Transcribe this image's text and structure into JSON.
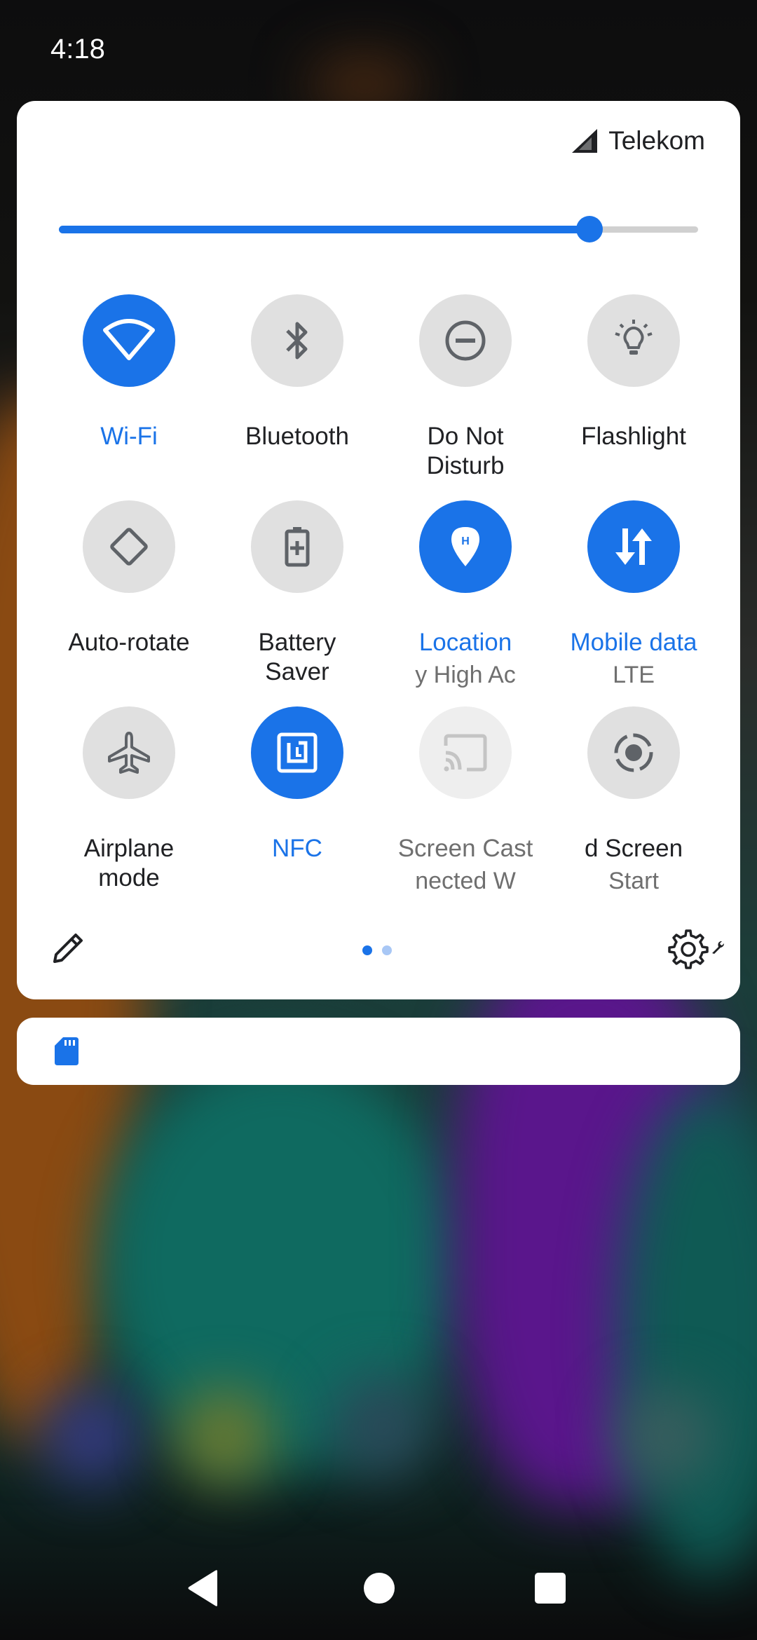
{
  "status_bar": {
    "time": "4:18"
  },
  "quick_settings": {
    "carrier": "Telekom",
    "brightness_level": 0.83,
    "tiles": [
      {
        "label": "Wi-Fi",
        "state": "on",
        "icon": "wifi-icon"
      },
      {
        "label": "Bluetooth",
        "state": "off",
        "icon": "bluetooth-icon"
      },
      {
        "label": "Do Not",
        "label2": "Disturb",
        "state": "off",
        "icon": "do-not-disturb-icon"
      },
      {
        "label": "Flashlight",
        "state": "off",
        "icon": "flashlight-icon"
      },
      {
        "label": "Auto-rotate",
        "state": "off",
        "icon": "auto-rotate-icon"
      },
      {
        "label": "Battery",
        "label2": "Saver",
        "state": "off",
        "icon": "battery-saver-icon"
      },
      {
        "label": "Location",
        "sub": "y    High Ac",
        "state": "on",
        "icon": "location-icon"
      },
      {
        "label": "Mobile data",
        "sub": "LTE",
        "state": "on",
        "icon": "mobile-data-icon"
      },
      {
        "label": "Airplane",
        "label2": "mode",
        "state": "off",
        "icon": "airplane-icon"
      },
      {
        "label": "NFC",
        "state": "on",
        "icon": "nfc-icon"
      },
      {
        "label": "Screen Cast",
        "sub": "nected     W",
        "state": "unavailable",
        "icon": "cast-icon"
      },
      {
        "label": "d      Screen",
        "sub": "Start",
        "state": "off",
        "icon": "screen-record-icon"
      }
    ],
    "page_indicator": {
      "pages": 2,
      "current": 1
    }
  },
  "colors": {
    "accent": "#1a73e8",
    "tile_off": "#e0e0e0",
    "panel": "#ffffff"
  },
  "notification": {
    "icon": "sd-card-icon"
  },
  "nav": {
    "back": "back-icon",
    "home": "home-icon",
    "recents": "recents-icon"
  }
}
